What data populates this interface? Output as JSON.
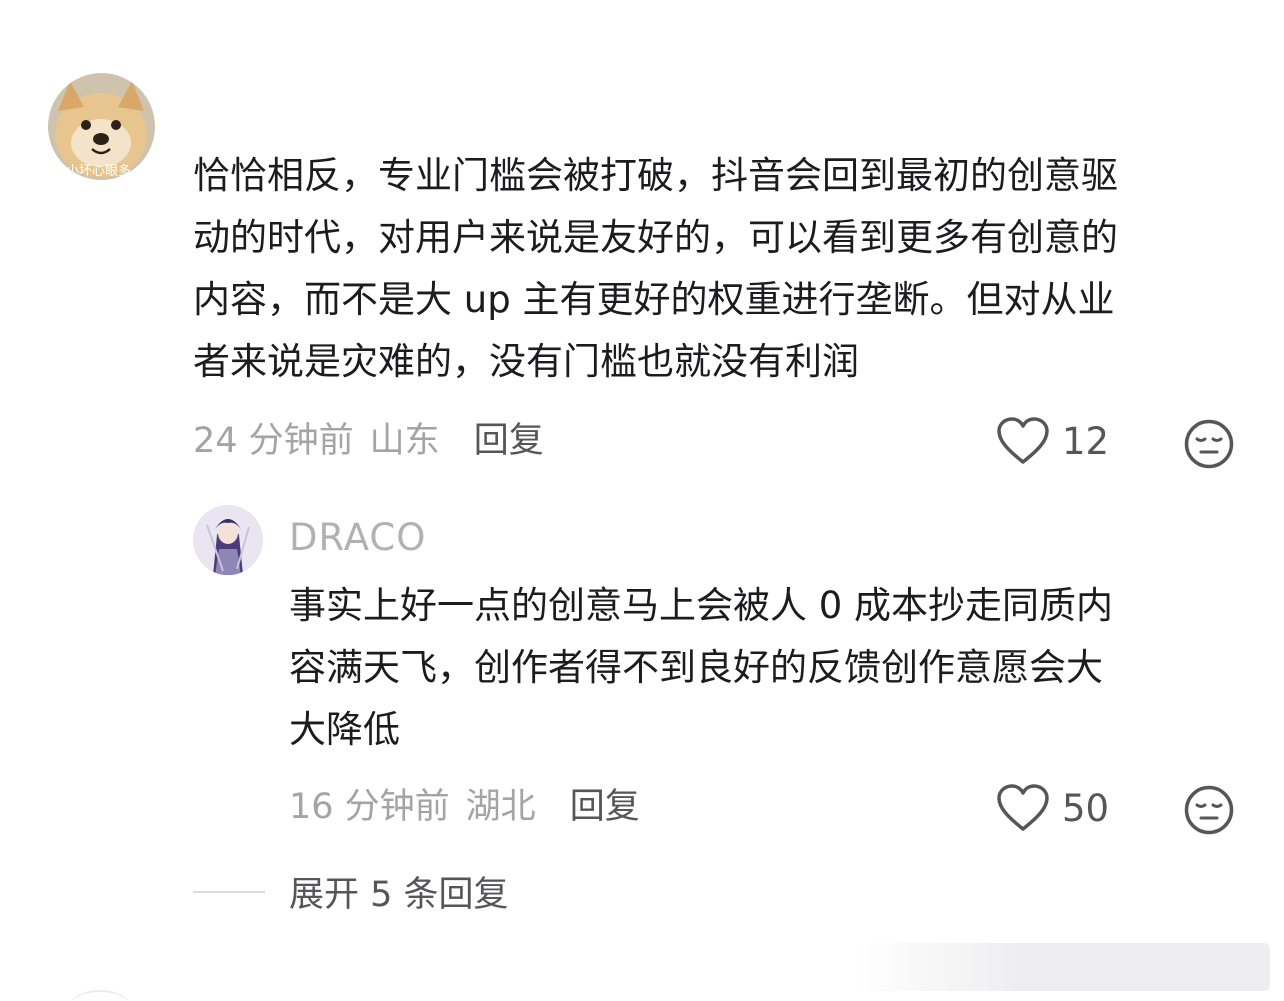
{
  "comment": {
    "avatar_icon": "shiba-dog-avatar",
    "avatar_caption": "小坏心眼多",
    "lines": [
      "恰恰相反，专业门槛会被打破，抖音会回到最初的创意驱",
      "动的时代，对用户来说是友好的，可以看到更多有创意的",
      "内容，而不是大 up 主有更好的权重进行垄断。但对从业",
      "者来说是灾难的，没有门槛也就没有利润"
    ],
    "time": "24 分钟前",
    "location": "山东",
    "reply_label": "回复",
    "like_count": "12",
    "like_icon": "heart-icon",
    "dislike_icon": "meh-face-icon"
  },
  "reply": {
    "avatar_icon": "anime-character-avatar",
    "username": "DRACO",
    "lines": [
      "事实上好一点的创意马上会被人 0 成本抄走同质内",
      "容满天飞，创作者得不到良好的反馈创作意愿会大",
      "大降低"
    ],
    "time": "16 分钟前",
    "location": "湖北",
    "reply_label": "回复",
    "like_count": "50",
    "like_icon": "heart-icon",
    "dislike_icon": "meh-face-icon"
  },
  "expand": {
    "label": "展开 5 条回复"
  }
}
